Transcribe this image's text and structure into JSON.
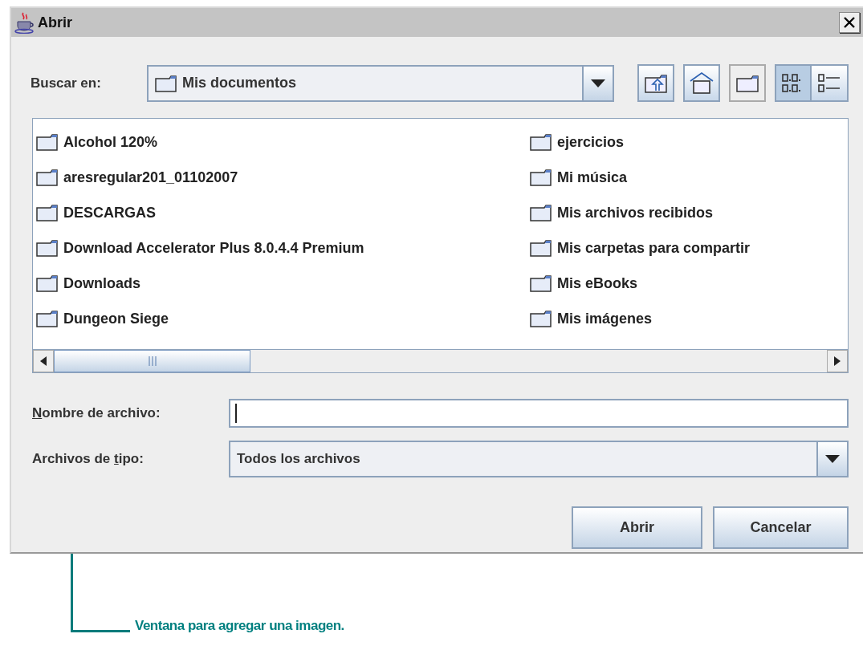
{
  "window": {
    "title": "Abrir"
  },
  "look_in": {
    "label": "Buscar en:",
    "value": "Mis documentos"
  },
  "view_modes": [
    {
      "kind": "list",
      "selected": true
    },
    {
      "kind": "details",
      "selected": false
    }
  ],
  "files": [
    "Alcohol 120%",
    "aresregular201_01102007",
    "DESCARGAS",
    "Download Accelerator Plus 8.0.4.4 Premium",
    "Downloads",
    "Dungeon Siege",
    "ejercicios",
    "Mi música",
    "Mis archivos recibidos",
    "Mis carpetas para compartir",
    "Mis eBooks",
    "Mis imágenes"
  ],
  "file_name": {
    "label": {
      "key": "N",
      "after": "ombre de archivo:"
    }
  },
  "file_type": {
    "label": {
      "before": "Archivos de ",
      "key": "t",
      "after": "ipo:"
    },
    "value": "Todos los archivos"
  },
  "buttons": [
    "Abrir",
    "Cancelar"
  ],
  "annotation": "Ventana para agregar una imagen."
}
